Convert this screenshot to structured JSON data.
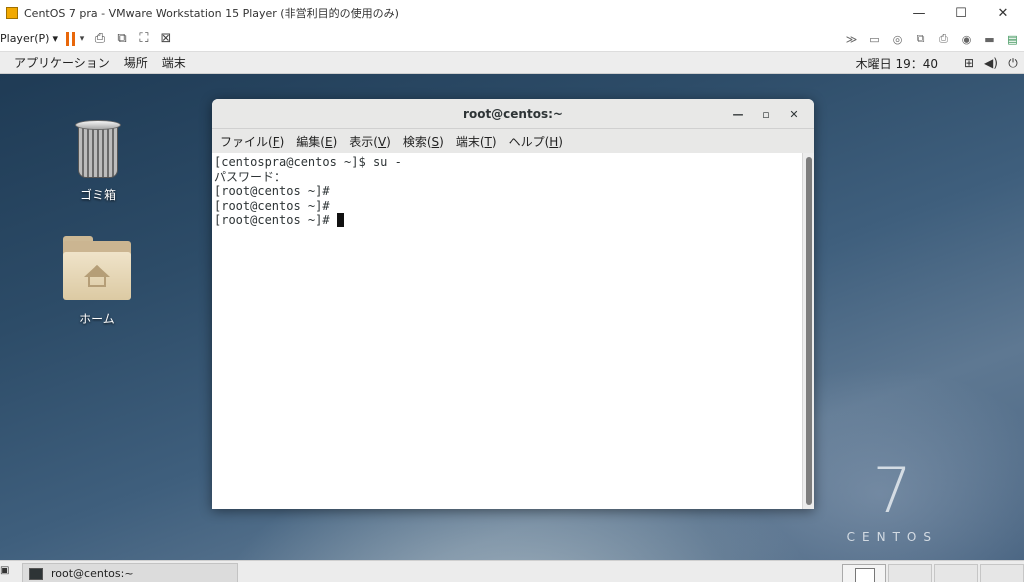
{
  "vm": {
    "title": "CentOS 7 pra - VMware Workstation 15 Player (非営利目的の使用のみ)",
    "player_menu": "Player(P)",
    "player_menu_arrow": "▾",
    "toolbar_icons": [
      "pause-icon",
      "send-ctrl-alt-del-icon",
      "removable-devices-icon",
      "fullscreen-icon",
      "unity-icon"
    ],
    "right_icons": [
      "more-icon",
      "harddisk-icon",
      "cd-icon",
      "network-icon",
      "printer-icon",
      "sound-icon",
      "usb-icon",
      "display-icon"
    ]
  },
  "gnome": {
    "applications": "アプリケーション",
    "places": "場所",
    "terminal": "端末",
    "clock": "木曜日 19：40"
  },
  "desktop": {
    "trash_label": "ゴミ箱",
    "home_label": "ホーム",
    "logo_number": "7",
    "logo_text": "CENTOS"
  },
  "terminal": {
    "title": "root@centos:~",
    "menus": [
      {
        "text": "ファイル(",
        "acc": "F",
        "end": ")"
      },
      {
        "text": "編集(",
        "acc": "E",
        "end": ")"
      },
      {
        "text": "表示(",
        "acc": "V",
        "end": ")"
      },
      {
        "text": "検索(",
        "acc": "S",
        "end": ")"
      },
      {
        "text": "端末(",
        "acc": "T",
        "end": ")"
      },
      {
        "text": "ヘルプ(",
        "acc": "H",
        "end": ")"
      }
    ],
    "lines": [
      "[centospra@centos ~]$ su -",
      "パスワード：",
      "[root@centos ~]#",
      "[root@centos ~]#",
      "[root@centos ~]# "
    ]
  },
  "taskbar": {
    "task_label": "root@centos:~"
  }
}
